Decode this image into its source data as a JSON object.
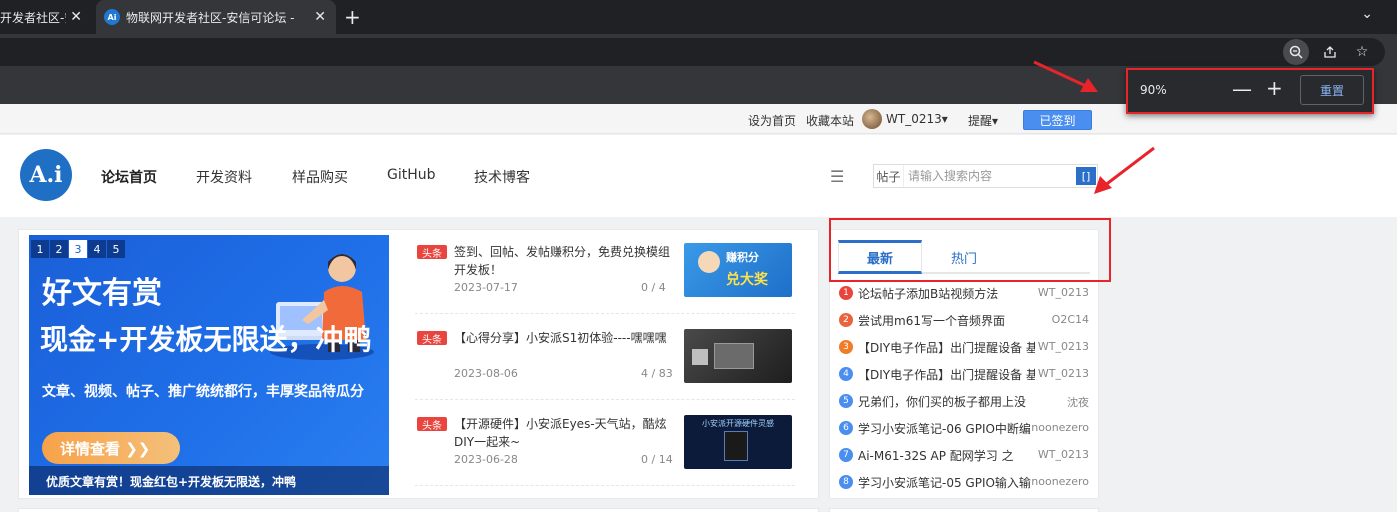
{
  "browser": {
    "tabs": [
      {
        "title": "开发者社区-安",
        "active": false
      },
      {
        "title": "物联网开发者社区-安信可论坛 -",
        "active": true
      }
    ],
    "new_tab": "+",
    "tab_menu": "⌄",
    "zoom_popup": {
      "level": "90%",
      "minus": "—",
      "plus": "+",
      "reset": "重置"
    }
  },
  "topnav": {
    "set_home": "设为首页",
    "bookmark": "收藏本站",
    "username": "WT_0213",
    "remind": "提醒",
    "signed": "已签到"
  },
  "header": {
    "logo_text": "A.i",
    "nav": [
      "论坛首页",
      "开发资料",
      "样品购买",
      "GitHub",
      "技术博客"
    ],
    "search_type": "帖子",
    "search_placeholder": "请输入搜索内容",
    "search_btn": "[]"
  },
  "banner": {
    "pages": [
      "1",
      "2",
      "3",
      "4",
      "5"
    ],
    "current_page": "3",
    "title1": "好文有赏",
    "title2": "现金+开发板无限送，冲鸭",
    "subtitle": "文章、视频、帖子、推广统统都行，丰厚奖品待瓜分",
    "button": "详情查看 ❯❯",
    "caption": "优质文章有赏！现金红包+开发板无限送，冲鸭"
  },
  "news": [
    {
      "tag": "头条",
      "title": "签到、回帖、发帖赚积分，免费兑换模组开发板！",
      "date": "2023-07-17",
      "stat": "0 / 4",
      "thumb_color": "#2a8fd8"
    },
    {
      "tag": "头条",
      "title": "【心得分享】小安派S1初体验----嘿嘿嘿",
      "date": "2023-08-06",
      "stat": "4 / 83",
      "thumb_color": "#2e2e2e"
    },
    {
      "tag": "头条",
      "title": "【开源硬件】小安派Eyes-天气站，酷炫DIY一起来~",
      "date": "2023-06-28",
      "stat": "0 / 14",
      "thumb_color": "#0d1b3a"
    }
  ],
  "thumb_texts": {
    "first_title": "赚积分",
    "first_sub": "兑大奖",
    "third": "小安派开源硬件灵感"
  },
  "side": {
    "tabs": [
      "最新",
      "热门"
    ],
    "ranks": [
      {
        "num": "1",
        "title": "论坛帖子添加B站视频方法",
        "user": "WT_0213",
        "color": "#e9453e"
      },
      {
        "num": "2",
        "title": "尝试用m61写一个音频界面",
        "user": "O2C14",
        "color": "#e9643e"
      },
      {
        "num": "3",
        "title": "【DIY电子作品】出门提醒设备 基",
        "user": "WT_0213",
        "color": "#f07c2a"
      },
      {
        "num": "4",
        "title": "【DIY电子作品】出门提醒设备 基",
        "user": "WT_0213",
        "color": "#4a8ef0"
      },
      {
        "num": "5",
        "title": "兄弟们，你们买的板子都用上没",
        "user": "沈夜",
        "color": "#4a8ef0"
      },
      {
        "num": "6",
        "title": "学习小安派笔记-06 GPIO中断编",
        "user": "noonezero",
        "color": "#4a8ef0"
      },
      {
        "num": "7",
        "title": "Ai-M61-32S AP 配网学习 之",
        "user": "WT_0213",
        "color": "#4a8ef0"
      },
      {
        "num": "8",
        "title": "学习小安派笔记-05 GPIO输入输",
        "user": "noonezero",
        "color": "#4a8ef0"
      }
    ]
  }
}
